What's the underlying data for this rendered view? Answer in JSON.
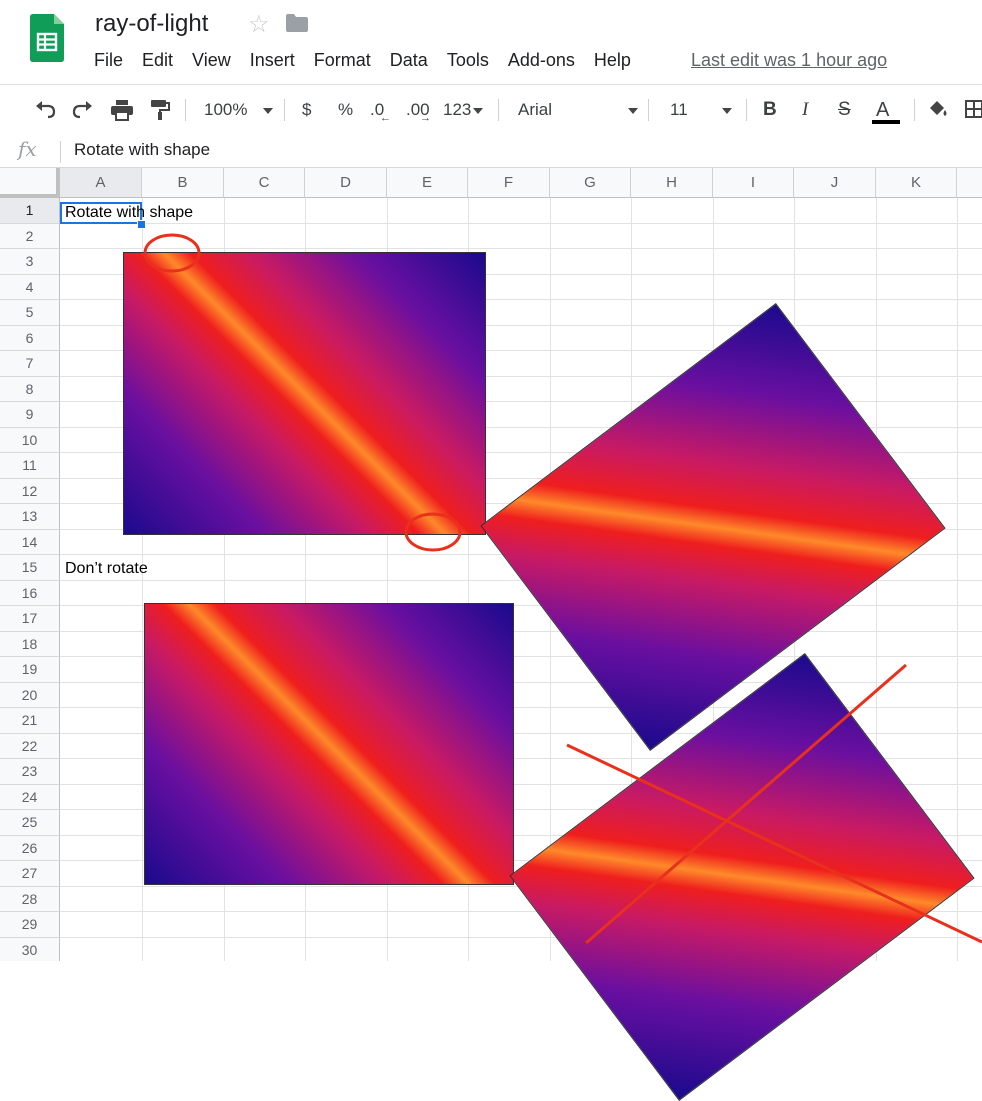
{
  "header": {
    "title": "ray-of-light",
    "menu": [
      "File",
      "Edit",
      "View",
      "Insert",
      "Format",
      "Data",
      "Tools",
      "Add-ons",
      "Help"
    ],
    "last_edit": "Last edit was 1 hour ago"
  },
  "toolbar": {
    "zoom": "100%",
    "currency": "$",
    "percent": "%",
    "decrease_decimals": ".0",
    "increase_decimals": ".00",
    "more_formats": "123",
    "font": "Arial",
    "font_size": "11",
    "bold": "B",
    "italic": "I",
    "strikethrough": "S",
    "text_color": "A"
  },
  "formula_bar": {
    "fx": "fx",
    "value": "Rotate with shape"
  },
  "sheet": {
    "columns": [
      "A",
      "B",
      "C",
      "D",
      "E",
      "F",
      "G",
      "H",
      "I",
      "J",
      "K"
    ],
    "rows": [
      "1",
      "2",
      "3",
      "4",
      "5",
      "6",
      "7",
      "8",
      "9",
      "10",
      "11",
      "12",
      "13",
      "14",
      "15",
      "16",
      "17",
      "18",
      "19",
      "20",
      "21",
      "22",
      "23",
      "24",
      "25",
      "26",
      "27",
      "28",
      "29",
      "30"
    ],
    "selected_cell": "A1",
    "cells": {
      "a1": "Rotate with shape",
      "a15": "Don’t rotate"
    }
  },
  "colors": {
    "logo_green": "#0f9d58",
    "selection_blue": "#1a73e8",
    "annotation_red": "#e8301c"
  }
}
